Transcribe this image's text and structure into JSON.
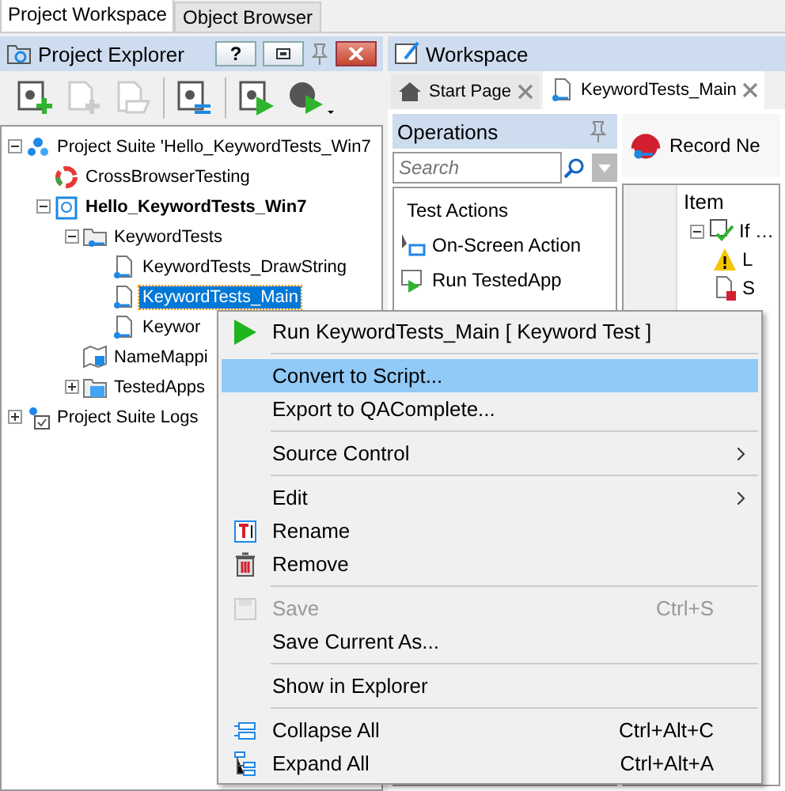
{
  "top_tabs": [
    {
      "label": "Project Workspace",
      "selected": true
    },
    {
      "label": "Object Browser",
      "selected": false
    }
  ],
  "project_explorer": {
    "title": "Project Explorer",
    "help_button": "?",
    "tree": [
      {
        "label": "Project Suite 'Hello_KeywordTests_Win7",
        "kind": "suite",
        "expanded": true,
        "active": false,
        "selected": false,
        "children": [
          {
            "label": "CrossBrowserTesting",
            "kind": "connector",
            "active": false,
            "selected": false
          },
          {
            "label": "Hello_KeywordTests_Win7",
            "kind": "project",
            "expanded": true,
            "active": true,
            "selected": false,
            "children": [
              {
                "label": "KeywordTests",
                "kind": "folder",
                "expanded": true,
                "active": false,
                "selected": false,
                "children": [
                  {
                    "label": "KeywordTests_DrawString",
                    "kind": "test",
                    "active": false,
                    "selected": false
                  },
                  {
                    "label": "KeywordTests_Main",
                    "kind": "test",
                    "active": false,
                    "selected": true
                  },
                  {
                    "label": "Keywor",
                    "kind": "test",
                    "active": false,
                    "selected": false
                  }
                ]
              },
              {
                "label": "NameMappi",
                "kind": "mapping",
                "active": false,
                "selected": false
              },
              {
                "label": "TestedApps",
                "kind": "apps",
                "expanded": false,
                "active": false,
                "selected": false
              }
            ]
          }
        ]
      },
      {
        "label": "Project Suite Logs",
        "kind": "logs",
        "expanded": false,
        "active": false,
        "selected": false
      }
    ]
  },
  "workspace": {
    "title": "Workspace",
    "tabs": [
      {
        "label": "Start Page",
        "kind": "home",
        "selected": false
      },
      {
        "label": "KeywordTests_Main",
        "kind": "test",
        "selected": true
      }
    ],
    "operations": {
      "title": "Operations",
      "search": {
        "placeholder": "Search"
      },
      "items": [
        {
          "label": "Test Actions",
          "kind": "header"
        },
        {
          "label": "On-Screen Action",
          "kind": "screen"
        },
        {
          "label": "Run TestedApp",
          "kind": "run"
        }
      ]
    },
    "toolbar": {
      "record_label": "Record Ne"
    },
    "grid": {
      "column": "Item",
      "rows": [
        {
          "label": "If …",
          "kind": "if"
        },
        {
          "label": "L",
          "kind": "warning"
        },
        {
          "label": "S",
          "kind": "doc"
        }
      ]
    }
  },
  "context_menu": [
    {
      "kind": "item",
      "label": "Run KeywordTests_Main  [ Keyword Test ]",
      "disabled": false,
      "selected": false,
      "submenu": false
    },
    {
      "kind": "separator"
    },
    {
      "kind": "item",
      "label": "Convert to Script...",
      "disabled": false,
      "selected": true,
      "submenu": false
    },
    {
      "kind": "item",
      "label": "Export to QAComplete...",
      "disabled": false,
      "selected": false,
      "submenu": false
    },
    {
      "kind": "separator"
    },
    {
      "kind": "item",
      "label": "Source Control",
      "disabled": false,
      "selected": false,
      "submenu": true
    },
    {
      "kind": "separator"
    },
    {
      "kind": "item",
      "label": "Edit",
      "disabled": false,
      "selected": false,
      "submenu": true
    },
    {
      "kind": "item",
      "label": "Rename",
      "disabled": false,
      "selected": false,
      "submenu": false
    },
    {
      "kind": "item",
      "label": "Remove",
      "disabled": false,
      "selected": false,
      "submenu": false
    },
    {
      "kind": "separator"
    },
    {
      "kind": "item",
      "label": "Save",
      "shortcut": "Ctrl+S",
      "disabled": true,
      "selected": false,
      "submenu": false
    },
    {
      "kind": "item",
      "label": "Save Current As...",
      "disabled": false,
      "selected": false,
      "submenu": false
    },
    {
      "kind": "separator"
    },
    {
      "kind": "item",
      "label": "Show in Explorer",
      "disabled": false,
      "selected": false,
      "submenu": false
    },
    {
      "kind": "separator"
    },
    {
      "kind": "item",
      "label": "Collapse All",
      "shortcut": "Ctrl+Alt+C",
      "disabled": false,
      "selected": false,
      "submenu": false
    },
    {
      "kind": "item",
      "label": "Expand All",
      "shortcut": "Ctrl+Alt+A",
      "disabled": false,
      "selected": false,
      "submenu": false
    }
  ]
}
